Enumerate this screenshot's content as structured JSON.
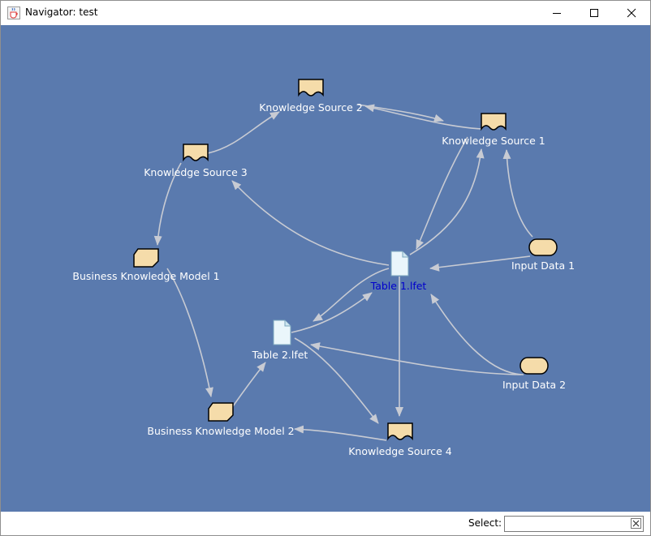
{
  "window": {
    "title": "Navigator: test"
  },
  "graph": {
    "nodes": [
      {
        "id": "ks1",
        "kind": "knowledge-source",
        "label": "Knowledge Source 1"
      },
      {
        "id": "ks2",
        "kind": "knowledge-source",
        "label": "Knowledge Source 2"
      },
      {
        "id": "ks3",
        "kind": "knowledge-source",
        "label": "Knowledge Source 3"
      },
      {
        "id": "ks4",
        "kind": "knowledge-source",
        "label": "Knowledge Source 4"
      },
      {
        "id": "bkm1",
        "kind": "business-knowledge-model",
        "label": "Business Knowledge Model 1"
      },
      {
        "id": "bkm2",
        "kind": "business-knowledge-model",
        "label": "Business Knowledge Model 2"
      },
      {
        "id": "in1",
        "kind": "input-data",
        "label": "Input Data 1"
      },
      {
        "id": "in2",
        "kind": "input-data",
        "label": "Input Data 2"
      },
      {
        "id": "t1",
        "kind": "decision-table",
        "label": "Table 1.lfet",
        "selected": true
      },
      {
        "id": "t2",
        "kind": "decision-table",
        "label": "Table 2.lfet"
      }
    ],
    "edges": [
      {
        "from": "ks2",
        "to": "ks1"
      },
      {
        "from": "ks1",
        "to": "ks2"
      },
      {
        "from": "ks3",
        "to": "ks2"
      },
      {
        "from": "ks3",
        "to": "bkm1"
      },
      {
        "from": "bkm1",
        "to": "bkm2"
      },
      {
        "from": "bkm2",
        "to": "t2"
      },
      {
        "from": "t1",
        "to": "ks3"
      },
      {
        "from": "ks1",
        "to": "t1"
      },
      {
        "from": "t1",
        "to": "ks1"
      },
      {
        "from": "in1",
        "to": "ks1"
      },
      {
        "from": "in1",
        "to": "t1"
      },
      {
        "from": "in2",
        "to": "t1"
      },
      {
        "from": "in2",
        "to": "t2"
      },
      {
        "from": "t1",
        "to": "t2"
      },
      {
        "from": "t2",
        "to": "t1"
      },
      {
        "from": "t1",
        "to": "ks4"
      },
      {
        "from": "t2",
        "to": "ks4"
      },
      {
        "from": "ks4",
        "to": "bkm2"
      }
    ]
  },
  "colors": {
    "canvas": "#5a7aae",
    "edge": "#c8cbd3",
    "node_fill": "#f5dcaa",
    "label": "#ffffff",
    "selected_label": "#0000cc"
  },
  "icons": {
    "app": "java-coffee-icon",
    "minimize": "minimize-icon",
    "maximize": "maximize-icon",
    "close": "close-icon",
    "clear": "clear-x-icon"
  },
  "statusbar": {
    "select_label": "Select:",
    "select_value": ""
  }
}
